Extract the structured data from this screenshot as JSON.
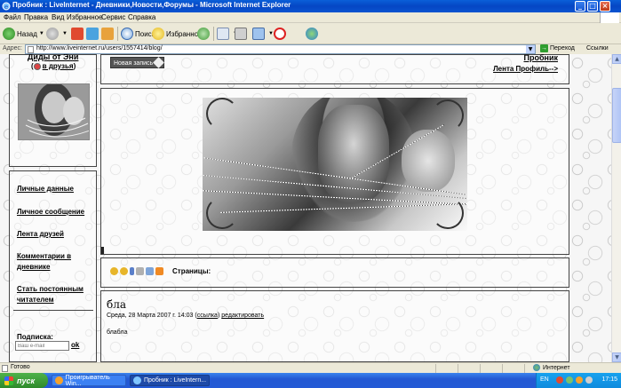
{
  "window": {
    "title": "Пробник : LiveInternet - Дневники,Новости,Форумы - Microsoft Internet Explorer",
    "minimize_label": "_",
    "maximize_label": "□",
    "close_label": "×"
  },
  "menu": [
    "Файл",
    "Правка",
    "Вид",
    "Избранное",
    "Сервис",
    "Справка"
  ],
  "toolbar": {
    "back_label": "Назад",
    "search_label": "Поиск",
    "favorites_label": "Избранное"
  },
  "address": {
    "label": "Адрес:",
    "url": "http://www.liveinternet.ru/users/1557414/blog/",
    "go_label": "Переход",
    "links_label": "Ссылки"
  },
  "sidebar": {
    "blog_name": "Диды от Эни",
    "to_friends": "в друзья",
    "menu_items": [
      "Личные данные",
      "Личное сообщение",
      "Лента друзей",
      "Комментарии в дневнике",
      "Стать постоянным читателем"
    ],
    "subscribe_label": "Подписка:",
    "email_placeholder": "Ваш e-mail",
    "ok_label": "ok"
  },
  "header": {
    "new_post_label": "Новая запись",
    "user_name": "Пробник",
    "links": "Лента Профиль-->"
  },
  "tools": {
    "pages_label": "Страницы:"
  },
  "post": {
    "title": "бла",
    "date": "Среда, 28 Марта 2007 г. 14:03",
    "link_label": "ссылка",
    "edit_label": "редактировать",
    "body": "блабла"
  },
  "status": {
    "text": "Готово",
    "zone": "Интернет"
  },
  "taskbar": {
    "start_label": "пуск",
    "tasks": [
      "Проигрыватель Win...",
      "Пробник : LiveIntern..."
    ],
    "lang": "EN",
    "clock": "17:15"
  }
}
